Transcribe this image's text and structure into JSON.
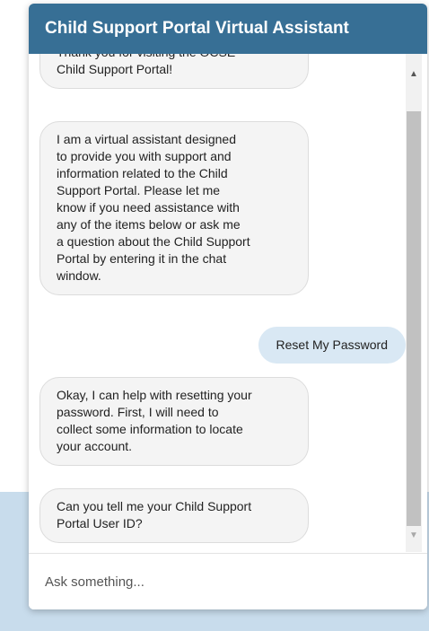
{
  "header": {
    "title": "Child Support Portal Virtual Assistant"
  },
  "messages": [
    {
      "sender": "bot",
      "text": "Thank you for visiting the OCSE\nChild Support Portal!"
    },
    {
      "sender": "bot",
      "text": "I am a virtual assistant designed\nto provide you with support and\ninformation related to the Child\nSupport Portal. Please let me\nknow if you need assistance with\nany of the items below or ask me\na question about the Child Support\nPortal by entering it in the chat\nwindow."
    },
    {
      "sender": "user",
      "text": "Reset My Password"
    },
    {
      "sender": "bot",
      "text": "Okay, I can help with resetting your\npassword. First, I will need to\ncollect some information to locate\nyour account."
    },
    {
      "sender": "bot",
      "text": "Can you tell me your Child Support\nPortal User ID?"
    }
  ],
  "input": {
    "placeholder": "Ask something..."
  },
  "scrollbar": {
    "up_icon": "triangle-up",
    "down_icon": "triangle-down"
  },
  "colors": {
    "header_bg": "#376f95",
    "bot_bubble_bg": "#f4f4f4",
    "user_bubble_bg": "#d9e8f4"
  }
}
